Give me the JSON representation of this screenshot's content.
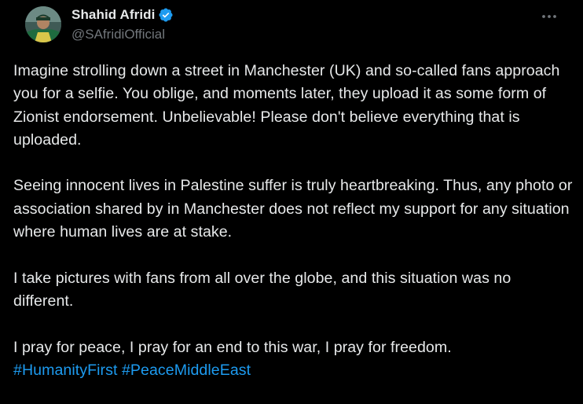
{
  "author": {
    "display_name": "Shahid Afridi",
    "handle": "@SAfridiOfficial",
    "verified_color": "#1d9bf0"
  },
  "icons": {
    "verified": "verified-badge-icon",
    "more": "more-options-icon"
  },
  "tweet": {
    "paragraphs": [
      "Imagine strolling down a street in Manchester (UK) and so-called fans approach you for a selfie. You oblige, and moments later, they upload it as some form of Zionist endorsement. Unbelievable! Please don't believe everything that is uploaded.",
      "Seeing innocent lives in Palestine suffer is truly heartbreaking. Thus, any photo or association shared by in Manchester does not reflect my support for any situation where human lives are at stake.",
      "I take pictures with fans from all over the globe, and this situation was no different.",
      "I pray for peace, I pray for an end to this war, I pray for freedom."
    ],
    "hashtags": [
      "#HumanityFirst",
      "#PeaceMiddleEast"
    ]
  },
  "colors": {
    "background": "#000000",
    "text": "#e7e9ea",
    "secondary_text": "#71767b",
    "link": "#1d9bf0"
  }
}
